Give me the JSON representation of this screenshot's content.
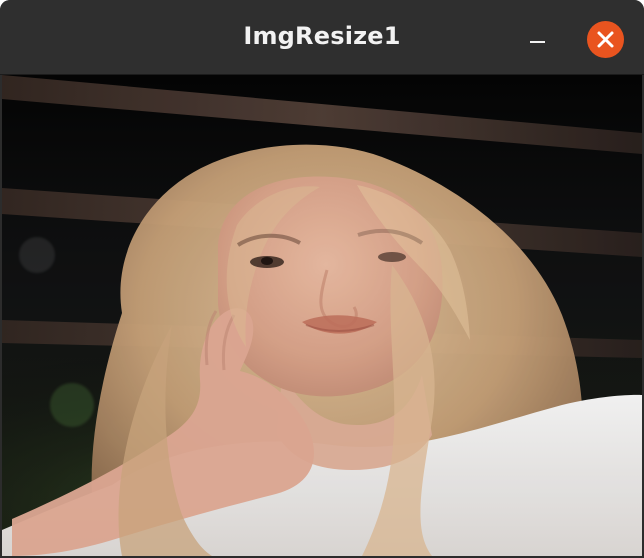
{
  "window": {
    "title": "ImgResize1",
    "controls": {
      "minimize_icon": "minimize-icon",
      "close_icon": "close-icon",
      "close_color": "#e9541f"
    }
  },
  "image": {
    "subject": "portrait-photo",
    "colors": {
      "background": "#0b0b0b",
      "hair": "#d8b48a",
      "skin": "#e7b49a",
      "shirt": "#f1eeec",
      "railing": "#4a3a33"
    }
  }
}
